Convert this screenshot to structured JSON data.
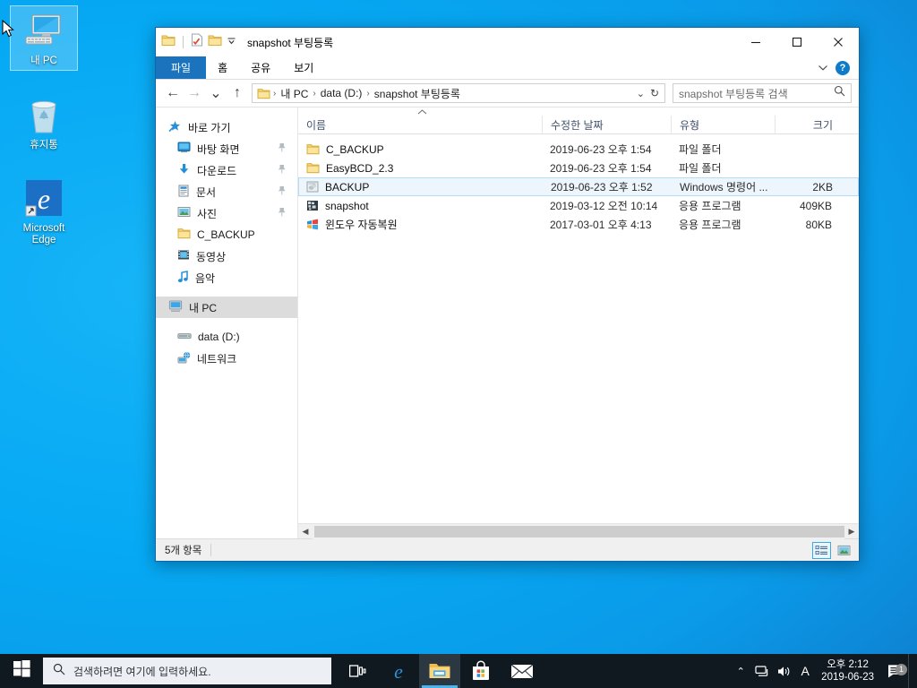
{
  "desktop": {
    "icons": [
      {
        "label": "내 PC",
        "icon": "this-pc-icon",
        "selected": true
      },
      {
        "label": "휴지통",
        "icon": "recycle-bin-icon",
        "selected": false
      },
      {
        "label": "Microsoft Edge",
        "icon": "edge-icon",
        "selected": false
      }
    ]
  },
  "window": {
    "title": "snapshot 부팅등록",
    "quick_access": [
      "folder-icon",
      "properties-icon",
      "new-folder-icon",
      "chevron-down-icon"
    ],
    "controls": {
      "minimize": "─",
      "maximize": "□",
      "close": "✕"
    },
    "ribbon_tabs": [
      {
        "label": "파일",
        "active": true
      },
      {
        "label": "홈",
        "active": false
      },
      {
        "label": "공유",
        "active": false
      },
      {
        "label": "보기",
        "active": false
      }
    ],
    "ribbon_collapse": "chevron-up-icon",
    "help_label": "?",
    "nav_buttons": {
      "back": "←",
      "forward": "→",
      "recent": "⌄",
      "up": "↑"
    },
    "breadcrumb": [
      "내 PC",
      "data (D:)",
      "snapshot 부팅등록"
    ],
    "breadcrumb_separator": "›",
    "address_dropdown": "⌄",
    "refresh": "↻",
    "search": {
      "placeholder": "snapshot 부팅등록 검색",
      "icon": "search-icon"
    }
  },
  "sidebar": {
    "items": [
      {
        "label": "바로 가기",
        "icon": "quick-access-star-icon",
        "level": 0,
        "pinned": false,
        "selected": false
      },
      {
        "label": "바탕 화면",
        "icon": "desktop-icon",
        "level": 1,
        "pinned": true,
        "selected": false
      },
      {
        "label": "다운로드",
        "icon": "downloads-icon",
        "level": 1,
        "pinned": true,
        "selected": false
      },
      {
        "label": "문서",
        "icon": "documents-icon",
        "level": 1,
        "pinned": true,
        "selected": false
      },
      {
        "label": "사진",
        "icon": "pictures-icon",
        "level": 1,
        "pinned": true,
        "selected": false
      },
      {
        "label": "C_BACKUP",
        "icon": "folder-icon",
        "level": 1,
        "pinned": false,
        "selected": false
      },
      {
        "label": "동영상",
        "icon": "videos-icon",
        "level": 1,
        "pinned": false,
        "selected": false
      },
      {
        "label": "음악",
        "icon": "music-icon",
        "level": 1,
        "pinned": false,
        "selected": false
      },
      {
        "label": "내 PC",
        "icon": "this-pc-icon",
        "level": 0,
        "pinned": false,
        "selected": true
      },
      {
        "label": "data (D:)",
        "icon": "drive-icon",
        "level": 0,
        "pinned": false,
        "selected": false
      },
      {
        "label": "네트워크",
        "icon": "network-icon",
        "level": 0,
        "pinned": false,
        "selected": false
      }
    ]
  },
  "file_list": {
    "columns": [
      "이름",
      "수정한 날짜",
      "유형",
      "크기"
    ],
    "sort_column": "이름",
    "sort_direction": "ascending",
    "rows": [
      {
        "name": "C_BACKUP",
        "date": "2019-06-23 오후 1:54",
        "type": "파일 폴더",
        "size": "",
        "icon": "folder-icon",
        "selected": false
      },
      {
        "name": "EasyBCD_2.3",
        "date": "2019-06-23 오후 1:54",
        "type": "파일 폴더",
        "size": "",
        "icon": "folder-icon",
        "selected": false
      },
      {
        "name": "BACKUP",
        "date": "2019-06-23 오후 1:52",
        "type": "Windows 명령어 ...",
        "size": "2KB",
        "icon": "batch-file-icon",
        "selected": true
      },
      {
        "name": "snapshot",
        "date": "2019-03-12 오전 10:14",
        "type": "응용 프로그램",
        "size": "409KB",
        "icon": "application-icon",
        "selected": false
      },
      {
        "name": "윈도우  자동복원",
        "date": "2017-03-01 오후 4:13",
        "type": "응용 프로그램",
        "size": "80KB",
        "icon": "windows-app-icon",
        "selected": false
      }
    ]
  },
  "status": {
    "item_count": "5개 항목",
    "view_buttons": [
      {
        "name": "details-view",
        "active": true
      },
      {
        "name": "large-icons-view",
        "active": false
      }
    ]
  },
  "taskbar": {
    "start": "windows-logo-icon",
    "search_placeholder": "검색하려면 여기에 입력하세요.",
    "apps": [
      {
        "name": "task-view",
        "active": false
      },
      {
        "name": "edge",
        "active": false
      },
      {
        "name": "file-explorer",
        "active": true
      },
      {
        "name": "microsoft-store",
        "active": false
      },
      {
        "name": "mail",
        "active": false
      }
    ],
    "tray": {
      "overflow": "⌃",
      "network": "network-icon",
      "volume": "volume-icon",
      "ime": "A",
      "time": "오후 2:12",
      "date": "2019-06-23",
      "notification_count": "1"
    }
  },
  "colors": {
    "accent": "#1b72bd",
    "desktop": "#06a9f4",
    "taskbar": "#101820",
    "selection": "#edf6fd"
  }
}
